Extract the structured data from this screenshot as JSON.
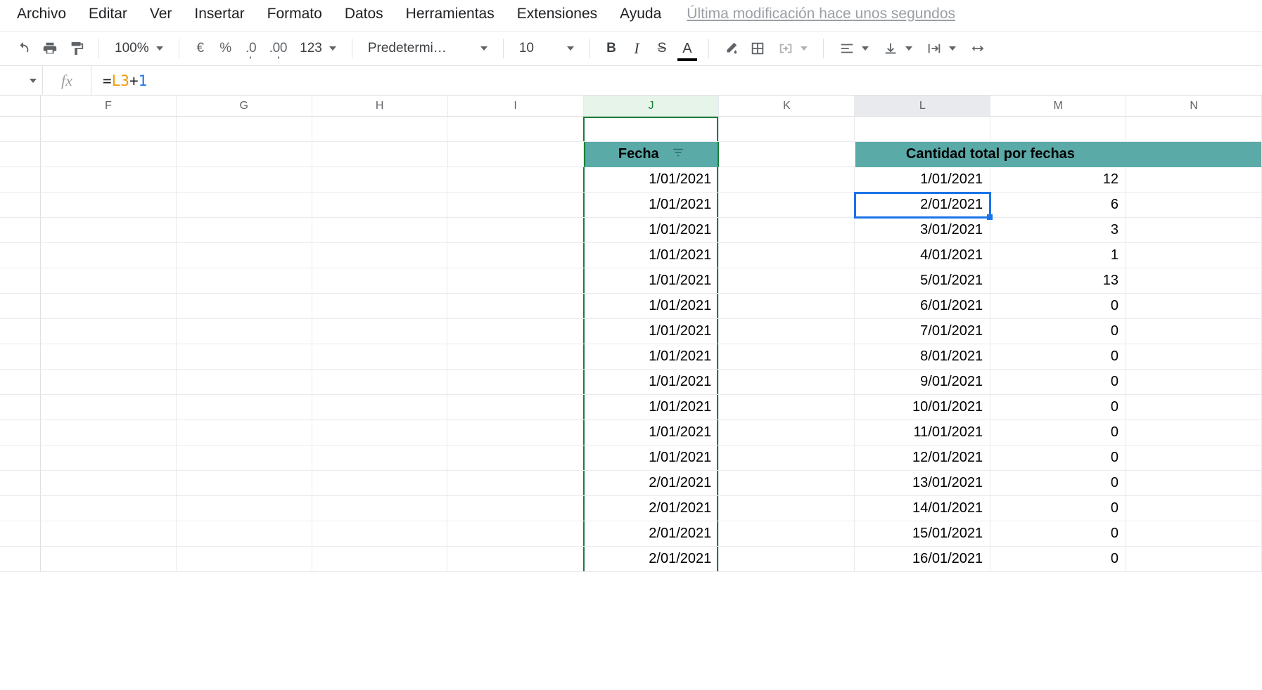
{
  "menu": {
    "items": [
      "Archivo",
      "Editar",
      "Ver",
      "Insertar",
      "Formato",
      "Datos",
      "Herramientas",
      "Extensiones",
      "Ayuda"
    ],
    "last_edit": "Última modificación hace unos segundos"
  },
  "toolbar": {
    "zoom": "100%",
    "currency": "€",
    "percent": "%",
    "dec_less": ".0",
    "dec_more": ".00",
    "format_123": "123",
    "font": "Predetermi…",
    "font_size": "10",
    "bold": "B",
    "italic": "I",
    "strike": "S",
    "text_color": "A"
  },
  "formula_bar": {
    "fx": "fx",
    "eq": "=",
    "ref": "L3",
    "plus": "+",
    "num": "1"
  },
  "columns": [
    "F",
    "G",
    "H",
    "I",
    "J",
    "K",
    "L",
    "M",
    "N"
  ],
  "active_col": "J",
  "shaded_col": "L",
  "headers": {
    "J": "Fecha",
    "LM": "Cantidad total por fechas"
  },
  "selected_cell": {
    "col": "L",
    "row_index": 1
  },
  "rows": [
    {
      "J": "1/01/2021",
      "L": "1/01/2021",
      "M": "12"
    },
    {
      "J": "1/01/2021",
      "L": "2/01/2021",
      "M": "6"
    },
    {
      "J": "1/01/2021",
      "L": "3/01/2021",
      "M": "3"
    },
    {
      "J": "1/01/2021",
      "L": "4/01/2021",
      "M": "1"
    },
    {
      "J": "1/01/2021",
      "L": "5/01/2021",
      "M": "13"
    },
    {
      "J": "1/01/2021",
      "L": "6/01/2021",
      "M": "0"
    },
    {
      "J": "1/01/2021",
      "L": "7/01/2021",
      "M": "0"
    },
    {
      "J": "1/01/2021",
      "L": "8/01/2021",
      "M": "0"
    },
    {
      "J": "1/01/2021",
      "L": "9/01/2021",
      "M": "0"
    },
    {
      "J": "1/01/2021",
      "L": "10/01/2021",
      "M": "0"
    },
    {
      "J": "1/01/2021",
      "L": "11/01/2021",
      "M": "0"
    },
    {
      "J": "1/01/2021",
      "L": "12/01/2021",
      "M": "0"
    },
    {
      "J": "2/01/2021",
      "L": "13/01/2021",
      "M": "0"
    },
    {
      "J": "2/01/2021",
      "L": "14/01/2021",
      "M": "0"
    },
    {
      "J": "2/01/2021",
      "L": "15/01/2021",
      "M": "0"
    },
    {
      "J": "2/01/2021",
      "L": "16/01/2021",
      "M": "0"
    }
  ]
}
